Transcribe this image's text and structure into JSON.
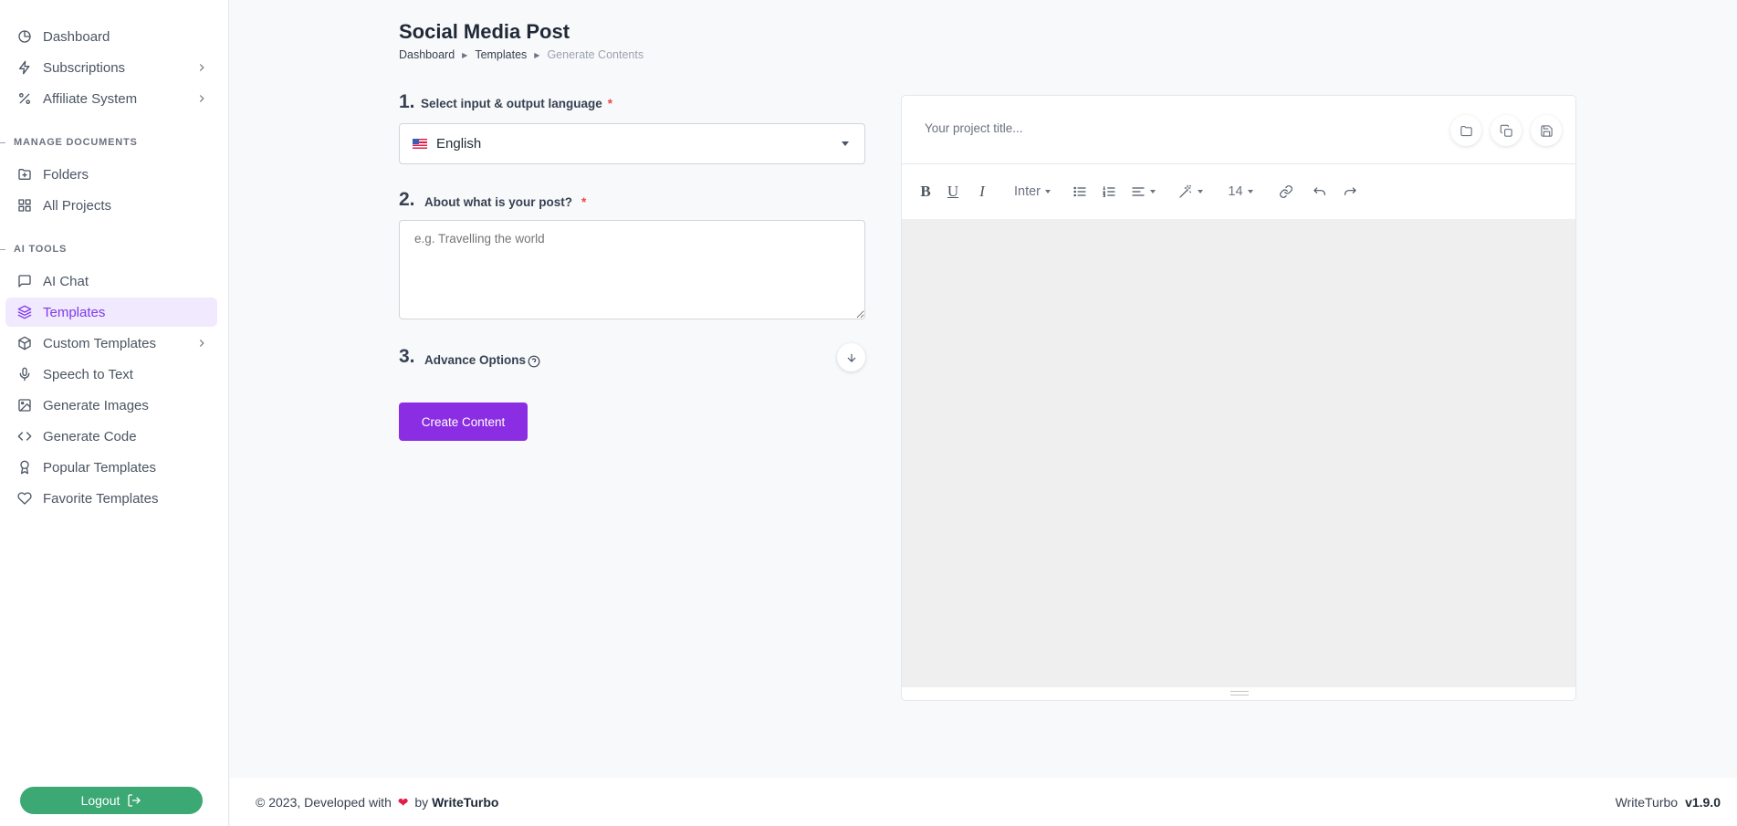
{
  "sidebar": {
    "items": [
      {
        "label": "Dashboard",
        "icon": "chart-pie-icon"
      },
      {
        "label": "Subscriptions",
        "icon": "bolt-icon"
      },
      {
        "label": "Affiliate System",
        "icon": "percent-icon"
      }
    ],
    "docs_section": "MANAGE DOCUMENTS",
    "docs_items": [
      {
        "label": "Folders",
        "icon": "folder-plus-icon"
      },
      {
        "label": "All Projects",
        "icon": "grid-icon"
      }
    ],
    "tools_section": "AI TOOLS",
    "tools_items": [
      {
        "label": "AI Chat",
        "icon": "chat-icon"
      },
      {
        "label": "Templates",
        "icon": "layers-icon",
        "active": true
      },
      {
        "label": "Custom Templates",
        "icon": "box-icon"
      },
      {
        "label": "Speech to Text",
        "icon": "mic-icon"
      },
      {
        "label": "Generate Images",
        "icon": "image-icon"
      },
      {
        "label": "Generate Code",
        "icon": "code-icon"
      },
      {
        "label": "Popular Templates",
        "icon": "award-icon"
      },
      {
        "label": "Favorite Templates",
        "icon": "heart-icon"
      }
    ],
    "logout_label": "Logout"
  },
  "header": {
    "title": "Social Media Post",
    "breadcrumb": [
      "Dashboard",
      "Templates",
      "Generate Contents"
    ]
  },
  "form": {
    "step1": {
      "num": "1.",
      "label": "Select input & output language",
      "required": "*"
    },
    "language_value": "English",
    "step2": {
      "num": "2.",
      "label": "About what is your post?",
      "required": "*"
    },
    "post_placeholder": "e.g. Travelling the world",
    "step3": {
      "num": "3.",
      "label": "Advance Options"
    },
    "create_label": "Create Content"
  },
  "editor": {
    "title_placeholder": "Your project title...",
    "font_family": "Inter",
    "font_size": "14",
    "bold": "B",
    "underline": "U",
    "italic": "I"
  },
  "footer": {
    "copyright": "© 2023, Developed with",
    "by": "by",
    "brand": "WriteTurbo",
    "app_name": "WriteTurbo",
    "version": "v1.9.0"
  },
  "colors": {
    "accent": "#8b2de2",
    "logout": "#3ca874",
    "active_bg": "#f1e9fd",
    "active_text": "#7c3aed"
  }
}
